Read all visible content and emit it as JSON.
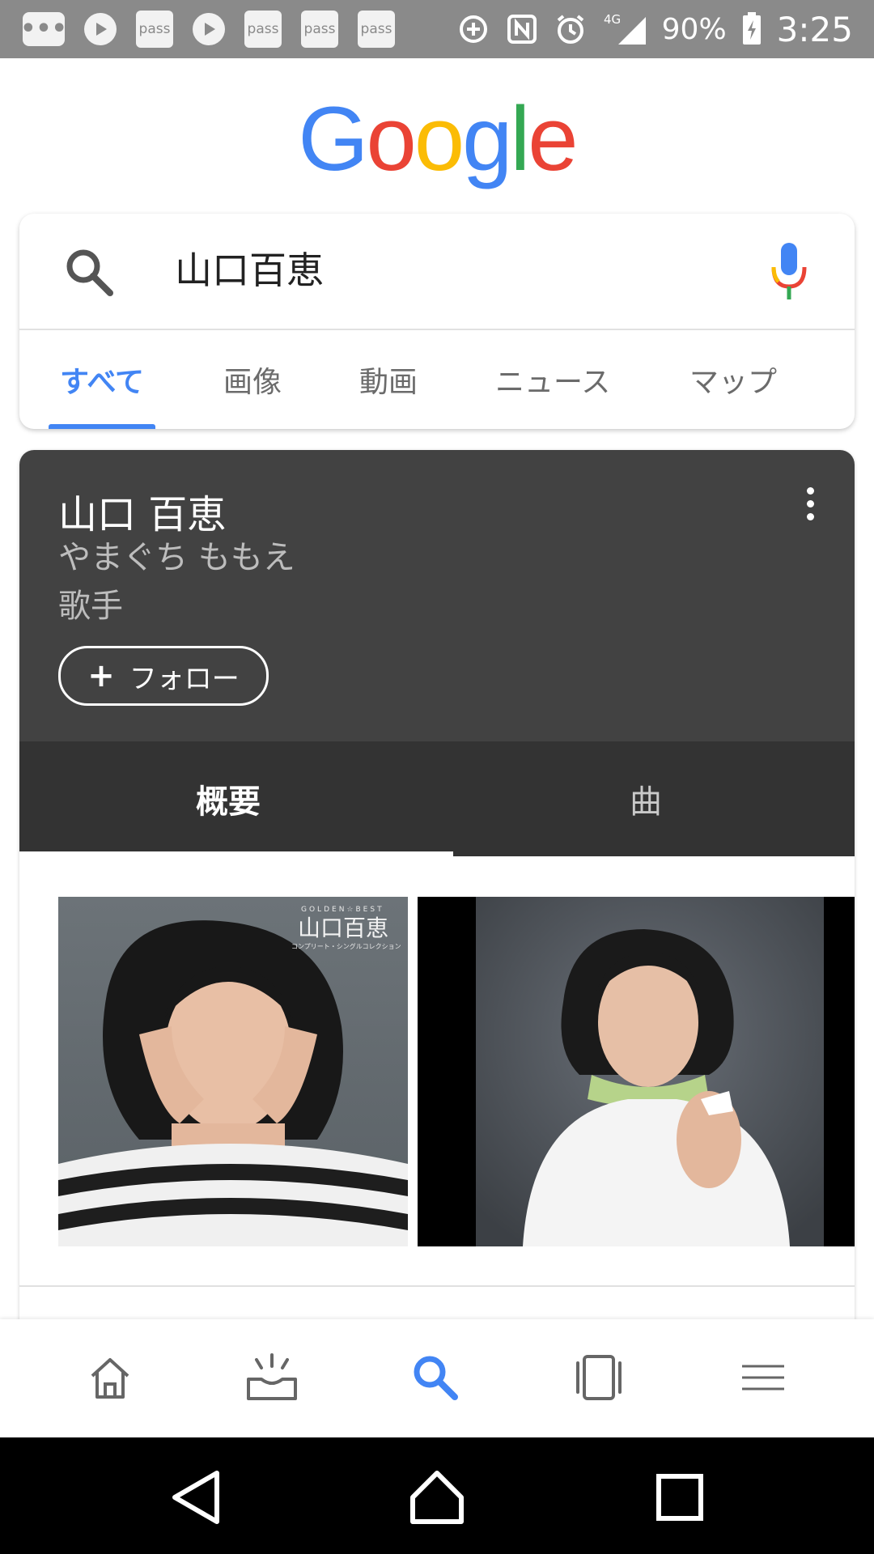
{
  "status_bar": {
    "notification_icons": [
      "more-notifications-icon",
      "play-icon",
      "pass-icon",
      "play-icon",
      "pass-icon",
      "pass-icon",
      "pass-icon"
    ],
    "pass_label": "pass",
    "dots_label": "•••",
    "network": "4G",
    "battery": "90%",
    "time": "3:25"
  },
  "logo": {
    "letters": [
      "G",
      "o",
      "o",
      "g",
      "l",
      "e"
    ],
    "colors": [
      "#4285f4",
      "#ea4335",
      "#fbbc05",
      "#4285f4",
      "#34a853",
      "#ea4335"
    ]
  },
  "search": {
    "query": "山口百恵"
  },
  "tabs": [
    {
      "label": "すべて",
      "active": true
    },
    {
      "label": "画像",
      "active": false
    },
    {
      "label": "動画",
      "active": false
    },
    {
      "label": "ニュース",
      "active": false
    },
    {
      "label": "マップ",
      "active": false
    }
  ],
  "knowledge_panel": {
    "title": "山口 百恵",
    "reading": "やまぐち ももえ",
    "subtitle": "歌手",
    "follow_label": "フォロー",
    "tabs": [
      {
        "label": "概要",
        "active": true
      },
      {
        "label": "曲",
        "active": false
      }
    ],
    "album_text": {
      "series": "GOLDEN☆BEST",
      "artist": "山口百恵",
      "caption": "コンプリート・シングルコレクション"
    }
  },
  "bottom_nav": [
    "home-icon",
    "updates-icon",
    "search-icon",
    "tabs-icon",
    "menu-icon"
  ],
  "colors": {
    "accent": "#4285f4",
    "panel_dark": "#424242",
    "panel_tabs": "#333333"
  }
}
